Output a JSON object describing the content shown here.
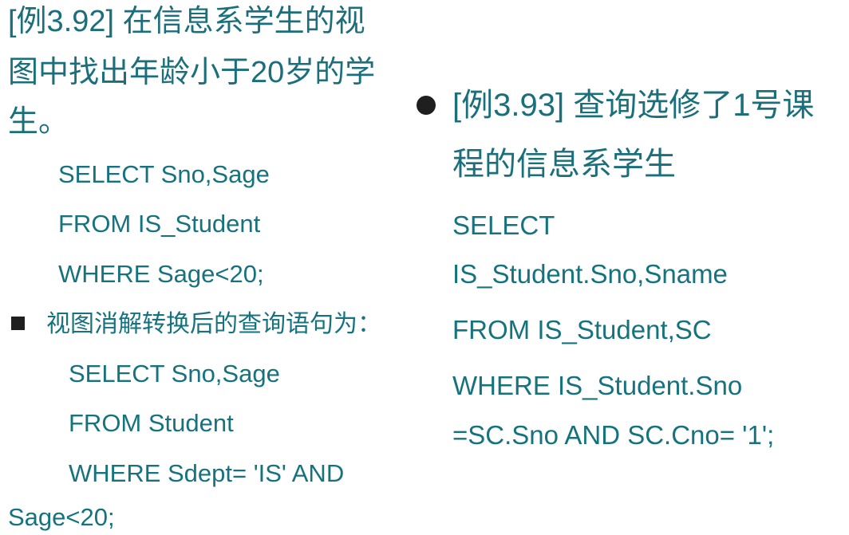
{
  "left": {
    "example_lines": [
      "[例3.92]  在信息系学生的视",
      "图中找出年龄小于20岁的学",
      "生。"
    ],
    "view_query": [
      "SELECT   Sno,Sage",
      "FROM     IS_Student",
      "WHERE   Sage<20;"
    ],
    "resolution_note": "视图消解转换后的查询语句为：",
    "resolved_query": [
      "SELECT  Sno,Sage",
      "FROM  Student",
      "WHERE  Sdept= 'IS'  AND",
      "Sage<20;"
    ]
  },
  "right": {
    "example_lines": [
      "[例3.93]  查询选修了1号课",
      "程的信息系学生"
    ],
    "query": [
      "SELECT",
      "IS_Student.Sno,Sname",
      "FROM     IS_Student,SC",
      "WHERE  IS_Student.Sno",
      "=SC.Sno AND SC.Cno= '1';"
    ]
  }
}
